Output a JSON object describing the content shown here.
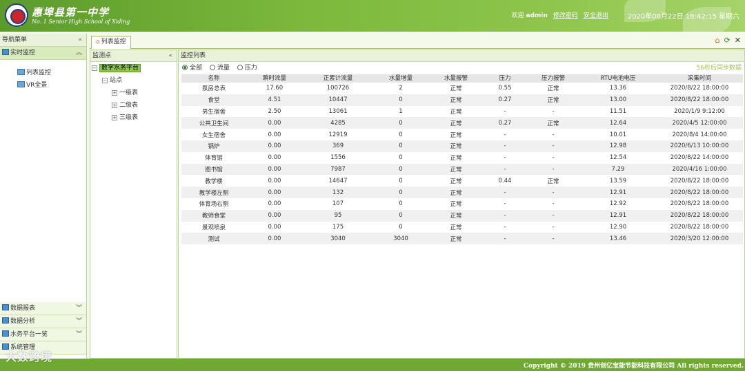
{
  "header": {
    "school_name": "惠埠县第一中学",
    "school_en": "No. 1 Senior High School of Xiding",
    "welcome": "欢迎",
    "user": "admin",
    "change_password": "修改密码",
    "logout": "安全退出",
    "datetime": "2020年08月22日 18:42:15 星期六"
  },
  "leftnav": {
    "title": "导航菜单",
    "active_section": "实时监控",
    "sub_items": [
      "列表监控",
      "VR全景"
    ],
    "bottom_sections": [
      "数据报表",
      "数据分析",
      "水务平台一览",
      "系统管理"
    ]
  },
  "tabs": {
    "active": "列表监控"
  },
  "monitor_panel": {
    "title": "监测点",
    "root": "数字水务平台",
    "station": "站点",
    "levels": [
      "一级表",
      "二级表",
      "三级表"
    ]
  },
  "list_panel": {
    "title": "监控列表",
    "filters": [
      "全部",
      "流量",
      "压力"
    ],
    "sync_note": "56秒后同步数据",
    "columns": [
      "名称",
      "瞬时流量",
      "正累计流量",
      "水量增量",
      "水量报警",
      "压力",
      "压力报警",
      "RTU电池电压",
      "采集时间"
    ],
    "rows": [
      [
        "泵房总表",
        "17.60",
        "100726",
        "2",
        "正常",
        "0.55",
        "正常",
        "13.36",
        "2020/8/22 18:00:00"
      ],
      [
        "食堂",
        "4.51",
        "10447",
        "0",
        "正常",
        "0.27",
        "正常",
        "13.00",
        "2020/8/22 18:00:00"
      ],
      [
        "男生宿舍",
        "2.50",
        "13061",
        "1",
        "正常",
        "-",
        "-",
        "11.51",
        "2020/1/9 9:12:00"
      ],
      [
        "公共卫生间",
        "0.00",
        "4285",
        "0",
        "正常",
        "0.27",
        "正常",
        "12.64",
        "2020/4/5 12:00:00"
      ],
      [
        "女生宿舍",
        "0.00",
        "12919",
        "0",
        "正常",
        "-",
        "-",
        "10.01",
        "2020/8/4 14:00:00"
      ],
      [
        "锅炉",
        "0.00",
        "369",
        "0",
        "正常",
        "-",
        "-",
        "12.98",
        "2020/6/13 10:00:00"
      ],
      [
        "体育馆",
        "0.00",
        "1556",
        "0",
        "正常",
        "-",
        "-",
        "12.54",
        "2020/8/22 14:00:00"
      ],
      [
        "图书馆",
        "0.00",
        "7987",
        "0",
        "正常",
        "-",
        "-",
        "7.29",
        "2020/4/16 1:00:00"
      ],
      [
        "教学楼",
        "0.00",
        "14647",
        "0",
        "正常",
        "0.44",
        "正常",
        "13.59",
        "2020/8/22 18:00:00"
      ],
      [
        "教学楼左侧",
        "0.00",
        "132",
        "0",
        "正常",
        "-",
        "-",
        "12.91",
        "2020/8/22 18:00:00"
      ],
      [
        "体育场右侧",
        "0.00",
        "107",
        "0",
        "正常",
        "-",
        "-",
        "12.92",
        "2020/8/22 18:00:00"
      ],
      [
        "教师食堂",
        "0.00",
        "95",
        "0",
        "正常",
        "-",
        "-",
        "12.91",
        "2020/8/22 18:00:00"
      ],
      [
        "景观喷泉",
        "0.00",
        "175",
        "0",
        "正常",
        "-",
        "-",
        "12.90",
        "2020/8/22 18:00:00"
      ],
      [
        "测试",
        "0.00",
        "3040",
        "3040",
        "正常",
        "-",
        "-",
        "13.46",
        "2020/3/20 12:00:00"
      ]
    ]
  },
  "footer": {
    "copyright": "Copyright © 2019 贵州创亿宝能节能科技有限公司 All rights reserved.",
    "watermark": "大数跨境"
  }
}
